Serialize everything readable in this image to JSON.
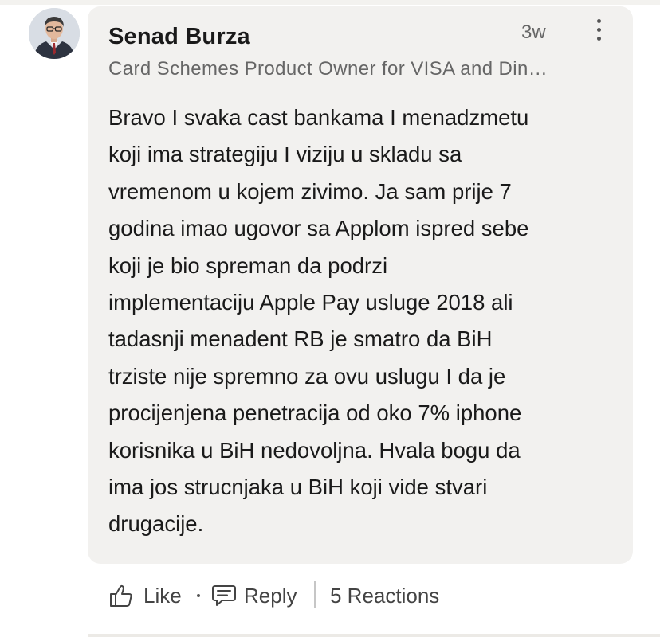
{
  "comment": {
    "author_name": "Senad Burza",
    "headline": "Card Schemes Product Owner for VISA and Din…",
    "timestamp": "3w",
    "body_lines": [
      "Bravo I svaka cast bankama I menadzmetu",
      "koji ima strategiju I viziju u skladu sa",
      "vremenom u kojem zivimo. Ja sam prije 7",
      "godina imao ugovor sa Applom ispred sebe",
      "koji je bio spreman da podrzi",
      "implementaciju Apple Pay usluge 2018 ali",
      "tadasnji menadent RB je smatro da BiH",
      "trziste nije spremno za ovu uslugu I da je",
      "procijenjena penetracija od oko 7% iphone",
      "korisnika u BiH nedovoljna. Hvala bogu da",
      "ima jos strucnjaka u BiH koji vide stvari",
      "drugacije."
    ]
  },
  "actions": {
    "like_label": "Like",
    "separator": "·",
    "reply_label": "Reply",
    "reactions_label": "5 Reactions"
  },
  "icons": {
    "avatar": "profile-photo",
    "more": "more-vertical-icon",
    "like": "thumbs-up-icon",
    "reply": "speech-bubble-icon"
  },
  "colors": {
    "bubble_background": "#f2f1ef",
    "primary_text": "#1a1a1a",
    "secondary_text": "#666666"
  }
}
